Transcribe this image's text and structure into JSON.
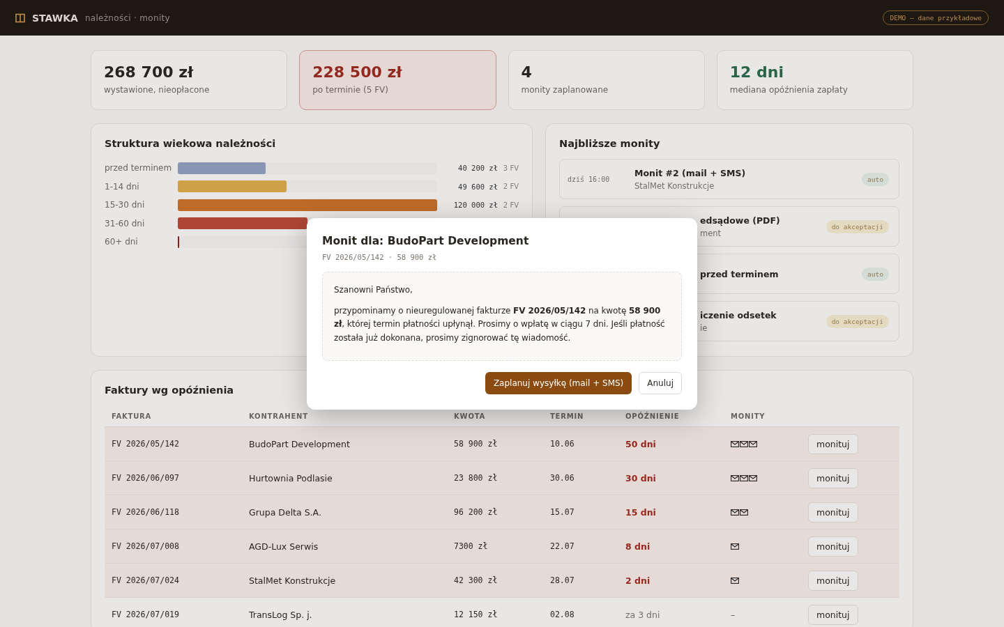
{
  "header": {
    "brand": "STAWKA",
    "subtitle": "należności · monity",
    "badge": "DEMO – dane przykładowe"
  },
  "kpis": [
    {
      "value": "268 700 zł",
      "label": "wystawione, nieopłacone",
      "color": "#2a2622",
      "alert": false
    },
    {
      "value": "228 500 zł",
      "label": "po terminie (5 FV)",
      "color": "#9a2b22",
      "alert": true
    },
    {
      "value": "4",
      "label": "monity zaplanowane",
      "color": "#2a2622",
      "alert": false
    },
    {
      "value": "12 dni",
      "label": "mediana opóźnienia zapłaty",
      "color": "#2c6b4a",
      "alert": false
    }
  ],
  "aging": {
    "title": "Struktura wiekowa należności",
    "rows": [
      {
        "label": "przed terminem",
        "level": 0.34,
        "color": "#8f9fbf",
        "amount": "40 200 zł",
        "count": "3 FV"
      },
      {
        "label": "1-14 dni",
        "level": 0.42,
        "color": "#d9ab4a",
        "amount": "49 600 zł",
        "count": "2 FV"
      },
      {
        "label": "15-30 dni",
        "level": 1.0,
        "color": "#c8702a",
        "amount": "120 000 zł",
        "count": "2 FV"
      },
      {
        "label": "31-60 dni",
        "level": 0.5,
        "color": "#b84a38"
      },
      {
        "label": "60+ dni",
        "level": 0.006,
        "color": "#8e1f1f"
      }
    ]
  },
  "upcoming": {
    "title": "Najbliższe monity",
    "items": [
      {
        "kind": "full",
        "time": "dziś 16:00",
        "title": "Monit #2 (mail + SMS)",
        "client": "StalMet Konstrukcje",
        "tag": "auto",
        "color": "#dfe9e2"
      },
      {
        "kind": "covered",
        "title": "edsądowe (PDF)",
        "client": "ment",
        "tag": "do akceptacji",
        "color": "#f1e6cc"
      },
      {
        "kind": "covered",
        "title": "przed terminem",
        "tag": "auto",
        "color": "#dfe9e2"
      },
      {
        "kind": "covered",
        "title": "iczenie odsetek",
        "client": "ie",
        "tag": "do akceptacji",
        "color": "#f1e6cc"
      }
    ]
  },
  "invoices": {
    "title": "Faktury wg opóźnienia",
    "columns": [
      "FAKTURA",
      "KONTRAHENT",
      "KWOTA",
      "TERMIN",
      "OPÓŹNIENIE",
      "MONITY"
    ],
    "rows": [
      {
        "invoice": "FV 2026/05/142",
        "client": "BudoPart Development",
        "amount": "58 900 zł",
        "due": "10.06",
        "delay": "50 dni",
        "overdue": true,
        "monits": [
          {
            "kind": "mail"
          },
          {
            "kind": "mail"
          },
          {
            "kind": "mail"
          }
        ],
        "action": "monituj"
      },
      {
        "invoice": "FV 2026/06/097",
        "client": "Hurtownia Podlasie",
        "amount": "23 800 zł",
        "due": "30.06",
        "delay": "30 dni",
        "overdue": true,
        "monits": [
          {
            "kind": "mail"
          },
          {
            "kind": "mail"
          },
          {
            "kind": "mail"
          }
        ],
        "action": "monituj"
      },
      {
        "invoice": "FV 2026/06/118",
        "client": "Grupa Delta S.A.",
        "amount": "96 200 zł",
        "due": "15.07",
        "delay": "15 dni",
        "overdue": true,
        "monits": [
          {
            "kind": "mail"
          },
          {
            "kind": "mail"
          }
        ],
        "action": "monituj"
      },
      {
        "invoice": "FV 2026/07/008",
        "client": "AGD-Lux Serwis",
        "amount": "7300 zł",
        "due": "22.07",
        "delay": "8 dni",
        "overdue": true,
        "monits": [
          {
            "kind": "mail"
          }
        ],
        "action": "monituj"
      },
      {
        "invoice": "FV 2026/07/024",
        "client": "StalMet Konstrukcje",
        "amount": "42 300 zł",
        "due": "28.07",
        "delay": "2 dni",
        "overdue": true,
        "monits": [
          {
            "kind": "mail"
          }
        ],
        "action": "monituj"
      },
      {
        "invoice": "FV 2026/07/019",
        "client": "TransLog Sp. j.",
        "amount": "12 150 zł",
        "due": "02.08",
        "delay": "za 3 dni",
        "overdue": false,
        "monits_empty": "–",
        "action": "monituj"
      }
    ]
  },
  "modal": {
    "title": "Monit dla: BudoPart Development",
    "meta": "FV 2026/05/142 · 58 900 zł",
    "greeting": "Szanowni Państwo,",
    "body": "przypominamy o nieuregulowanej fakturze **FV 2026/05/142** na kwotę **58 900 zł**, której termin płatności upłynął. Prosimy o wpłatę w ciągu 7 dni. Jeśli płatność została już dokonana, prosimy zignorować tę wiadomość.",
    "primary": "Zaplanuj wysyłkę (mail + SMS)",
    "secondary": "Anuluj"
  }
}
